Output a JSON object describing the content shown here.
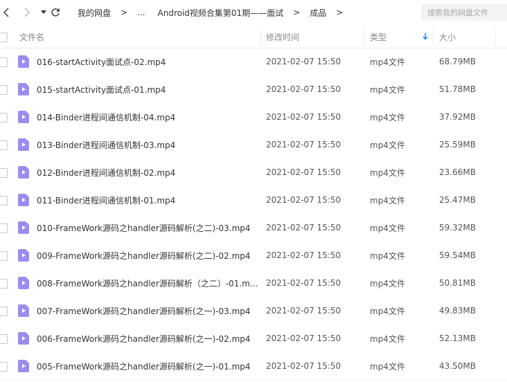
{
  "breadcrumb": {
    "items": [
      "我的网盘",
      "Android视频合集第01期——面试",
      "成品"
    ],
    "ellipsis": "..."
  },
  "search": {
    "placeholder": "搜索我的网盘文件"
  },
  "columns": {
    "name": "文件名",
    "modified": "修改时间",
    "type": "类型",
    "size": "大小"
  },
  "colors": {
    "video_icon": "#9b8cf1",
    "sort_arrow": "#1e7cf2"
  },
  "files": [
    {
      "name": "016-startActivity面试点-02.mp4",
      "modified": "2021-02-07 15:50",
      "type": "mp4文件",
      "size": "68.79MB"
    },
    {
      "name": "015-startActivity面试点-01.mp4",
      "modified": "2021-02-07 15:50",
      "type": "mp4文件",
      "size": "51.78MB"
    },
    {
      "name": "014-Binder进程间通信机制-04.mp4",
      "modified": "2021-02-07 15:50",
      "type": "mp4文件",
      "size": "37.92MB"
    },
    {
      "name": "013-Binder进程间通信机制-03.mp4",
      "modified": "2021-02-07 15:50",
      "type": "mp4文件",
      "size": "25.59MB"
    },
    {
      "name": "012-Binder进程间通信机制-02.mp4",
      "modified": "2021-02-07 15:50",
      "type": "mp4文件",
      "size": "23.66MB"
    },
    {
      "name": "011-Binder进程间通信机制-01.mp4",
      "modified": "2021-02-07 15:50",
      "type": "mp4文件",
      "size": "25.47MB"
    },
    {
      "name": "010-FrameWork源码之handler源码解析(之二)-03.mp4",
      "modified": "2021-02-07 15:50",
      "type": "mp4文件",
      "size": "59.32MB"
    },
    {
      "name": "009-FrameWork源码之handler源码解析(之二)-02.mp4",
      "modified": "2021-02-07 15:50",
      "type": "mp4文件",
      "size": "59.54MB"
    },
    {
      "name": "008-FrameWork源码之handler源码解析（之二）-01.m...",
      "modified": "2021-02-07 15:50",
      "type": "mp4文件",
      "size": "50.81MB"
    },
    {
      "name": "007-FrameWork源码之handler源码解析(之一)-03.mp4",
      "modified": "2021-02-07 15:50",
      "type": "mp4文件",
      "size": "49.83MB"
    },
    {
      "name": "006-FrameWork源码之handler源码解析(之一)-02.mp4",
      "modified": "2021-02-07 15:50",
      "type": "mp4文件",
      "size": "52.13MB"
    },
    {
      "name": "005-FrameWork源码之handler源码解析(之一)-01.mp4",
      "modified": "2021-02-07 15:50",
      "type": "mp4文件",
      "size": "43.50MB"
    }
  ]
}
